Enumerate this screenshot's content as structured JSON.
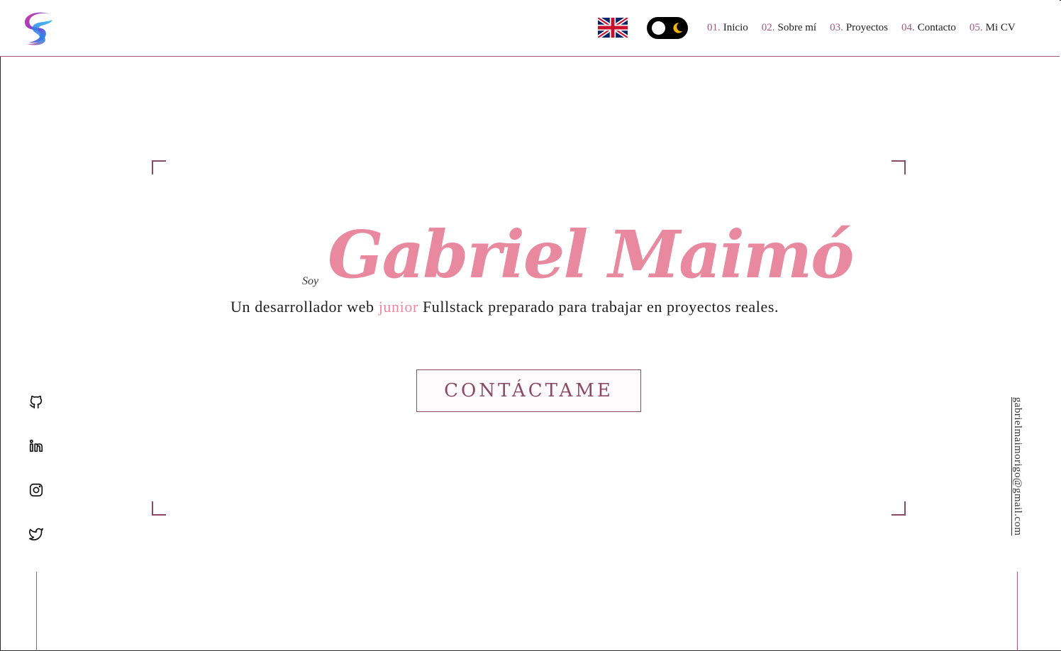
{
  "header": {
    "logo_icon": "logo-icon",
    "language_flag_icon": "uk-flag-icon",
    "theme_toggle_icon": "moon-icon",
    "nav": [
      {
        "num": "01.",
        "label": "Inicio"
      },
      {
        "num": "02.",
        "label": "Sobre mí"
      },
      {
        "num": "03.",
        "label": "Proyectos"
      },
      {
        "num": "04.",
        "label": "Contacto"
      },
      {
        "num": "05.",
        "label": "Mi CV"
      }
    ]
  },
  "hero": {
    "intro": "Soy",
    "name": "Gabriel Maimó",
    "tagline_before": "Un desarrollador web ",
    "tagline_accent": "junior",
    "tagline_after": " Fullstack preparado para trabajar en proyectos reales.",
    "cta_label": "CONTÁCTAME"
  },
  "socials": [
    "github-icon",
    "linkedin-icon",
    "instagram-icon",
    "twitter-icon"
  ],
  "email": "gabrielmaimorigo@gmail.com",
  "colors": {
    "accent_pink": "#e8899f",
    "accent_plum": "#8b4a63",
    "line": "#a05a7a",
    "toggle_bg": "#000000",
    "moon": "#f5b301"
  }
}
